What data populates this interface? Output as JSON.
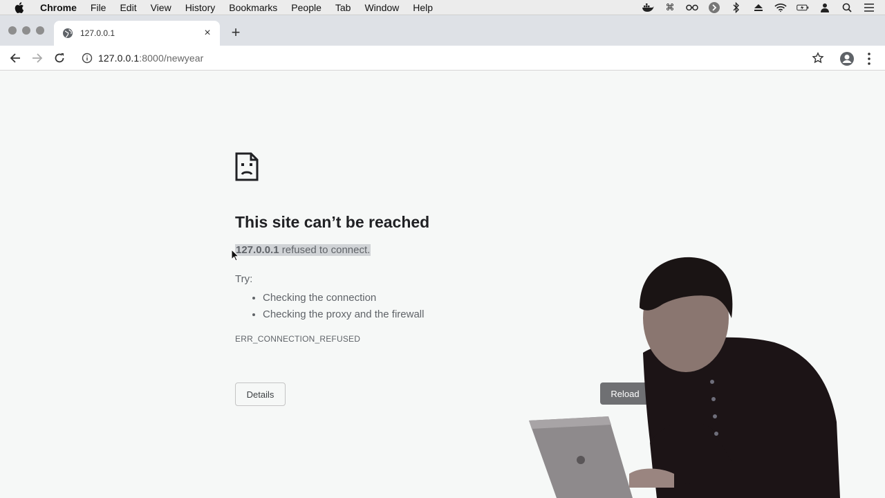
{
  "menubar": {
    "app_name": "Chrome",
    "items": [
      "File",
      "Edit",
      "View",
      "History",
      "Bookmarks",
      "People",
      "Tab",
      "Window",
      "Help"
    ],
    "status_icons": [
      "docker-icon",
      "command-icon",
      "glasses-icon",
      "forward-circle-icon",
      "bluetooth-icon",
      "eject-icon",
      "wifi-icon",
      "battery-icon",
      "user-icon",
      "search-icon",
      "list-icon"
    ]
  },
  "tab": {
    "title": "127.0.0.1",
    "close_symbol": "×",
    "new_tab_symbol": "+"
  },
  "toolbar": {
    "url_host": "127.0.0.1",
    "url_path": ":8000/newyear"
  },
  "error_page": {
    "headline": "This site can’t be reached",
    "refused_host": "127.0.0.1",
    "refused_message": " refused to connect.",
    "try_label": "Try:",
    "suggestions": [
      "Checking the connection",
      "Checking the proxy and the firewall"
    ],
    "error_code": "ERR_CONNECTION_REFUSED",
    "details_button": "Details",
    "reload_button": "Reload"
  },
  "colors": {
    "page_background": "#f6f8f7",
    "reload_button": "#6f7073",
    "text_primary": "#202124",
    "text_secondary": "#5f6368"
  }
}
